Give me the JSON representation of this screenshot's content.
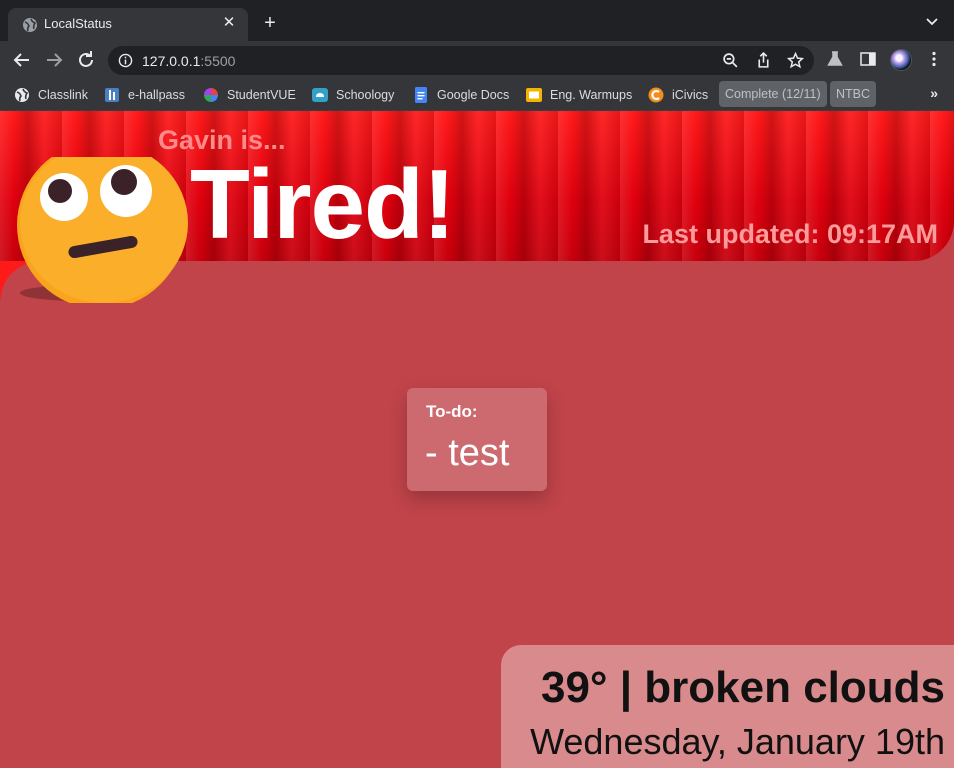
{
  "browser": {
    "tab_title": "LocalStatus",
    "tab_close": "✕",
    "new_tab": "+",
    "url_host": "127.0.0.1",
    "url_port": ":5500",
    "bookmarks": [
      {
        "label": "Classlink",
        "icon": "globe-icon"
      },
      {
        "label": "e-hallpass",
        "icon": "hallpass-icon"
      },
      {
        "label": "StudentVUE",
        "icon": "studentvue-icon"
      },
      {
        "label": "Schoology",
        "icon": "schoology-icon"
      },
      {
        "label": "Google Docs",
        "icon": "google-docs-icon"
      },
      {
        "label": "Eng. Warmups",
        "icon": "google-slides-icon"
      },
      {
        "label": "iCivics",
        "icon": "icivics-icon"
      }
    ],
    "bookmark_folders": [
      "Complete (12/11)",
      "NTBC"
    ],
    "more_bookmarks": "»"
  },
  "page": {
    "subtitle": "Gavin is...",
    "status": "Tired!",
    "last_updated": "Last updated: 09:17AM",
    "emoji": "face-with-rolling-eyes-icon",
    "todo": {
      "title": "To-do:",
      "items": [
        "- test"
      ]
    },
    "weather": {
      "summary": "39° | broken clouds",
      "date": "Wednesday, January 19th"
    }
  },
  "colors": {
    "header_red": "#e0000e",
    "page_bg": "#c0444a",
    "todo_bg": "#cc6a70",
    "weather_bg": "#d98a8c",
    "subtitle": "#ff8a8a"
  }
}
